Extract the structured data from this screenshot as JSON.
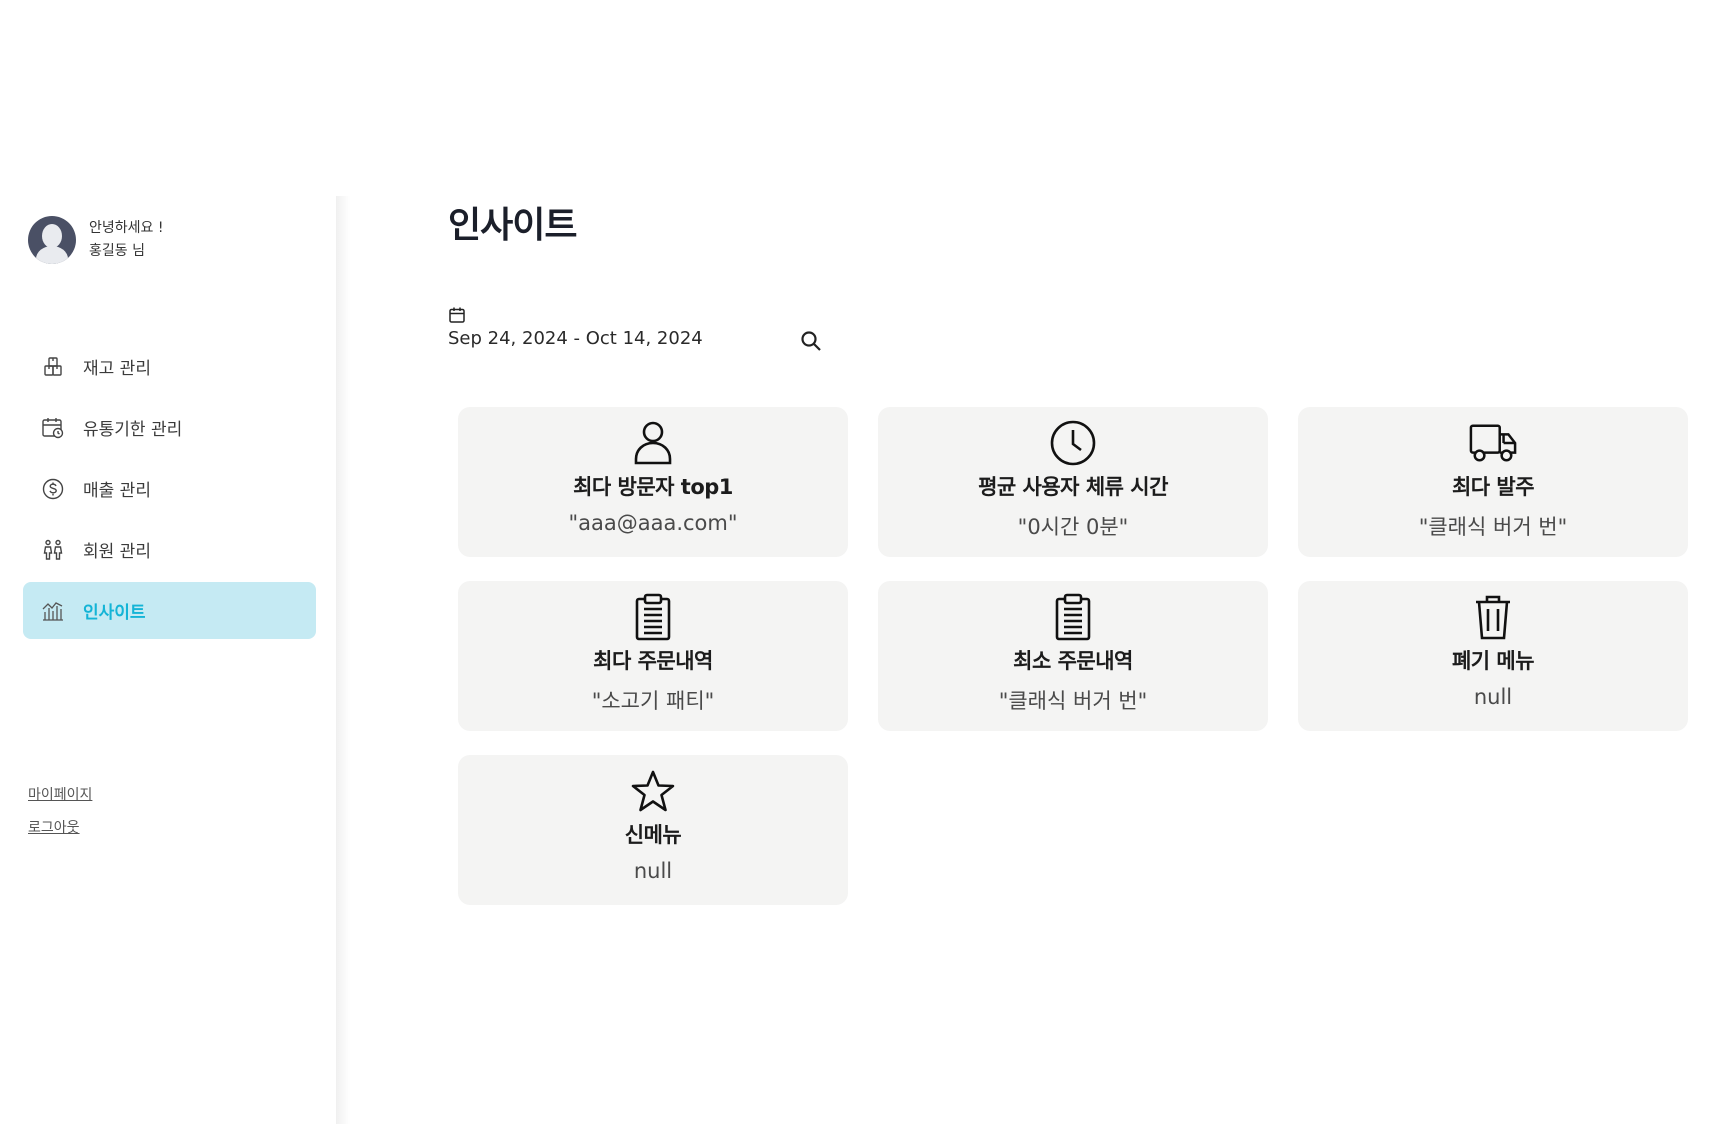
{
  "user": {
    "greeting": "안녕하세요 !",
    "name": "홍길동 님"
  },
  "nav": {
    "items": [
      {
        "label": "재고 관리",
        "icon": "inventory-icon"
      },
      {
        "label": "유통기한 관리",
        "icon": "calendar-clock-icon"
      },
      {
        "label": "매출 관리",
        "icon": "dollar-circle-icon"
      },
      {
        "label": "회원 관리",
        "icon": "people-icon"
      },
      {
        "label": "인사이트",
        "icon": "insight-chart-icon",
        "active": true
      }
    ]
  },
  "footer": {
    "mypage": "마이페이지",
    "logout": "로그아웃"
  },
  "main": {
    "title": "인사이트",
    "date_range": "Sep 24, 2024 - Oct 14, 2024"
  },
  "cards": [
    {
      "title": "최다 방문자 top1",
      "value": "\"aaa@aaa.com\"",
      "icon": "user-icon"
    },
    {
      "title": "평균 사용자 체류 시간",
      "value": "\"0시간 0분\"",
      "icon": "clock-icon"
    },
    {
      "title": "최다 발주",
      "value": "\"클래식 버거 번\"",
      "icon": "truck-icon"
    },
    {
      "title": "최다 주문내역",
      "value": "\"소고기 패티\"",
      "icon": "clipboard-icon"
    },
    {
      "title": "최소 주문내역",
      "value": "\"클래식 버거 번\"",
      "icon": "clipboard-icon"
    },
    {
      "title": "폐기 메뉴",
      "value": "null",
      "icon": "trash-icon"
    },
    {
      "title": "신메뉴",
      "value": "null",
      "icon": "star-icon"
    }
  ],
  "colors": {
    "accent": "#14b4d6",
    "active_bg": "#c5eaf3",
    "card_bg": "#f4f4f3"
  }
}
